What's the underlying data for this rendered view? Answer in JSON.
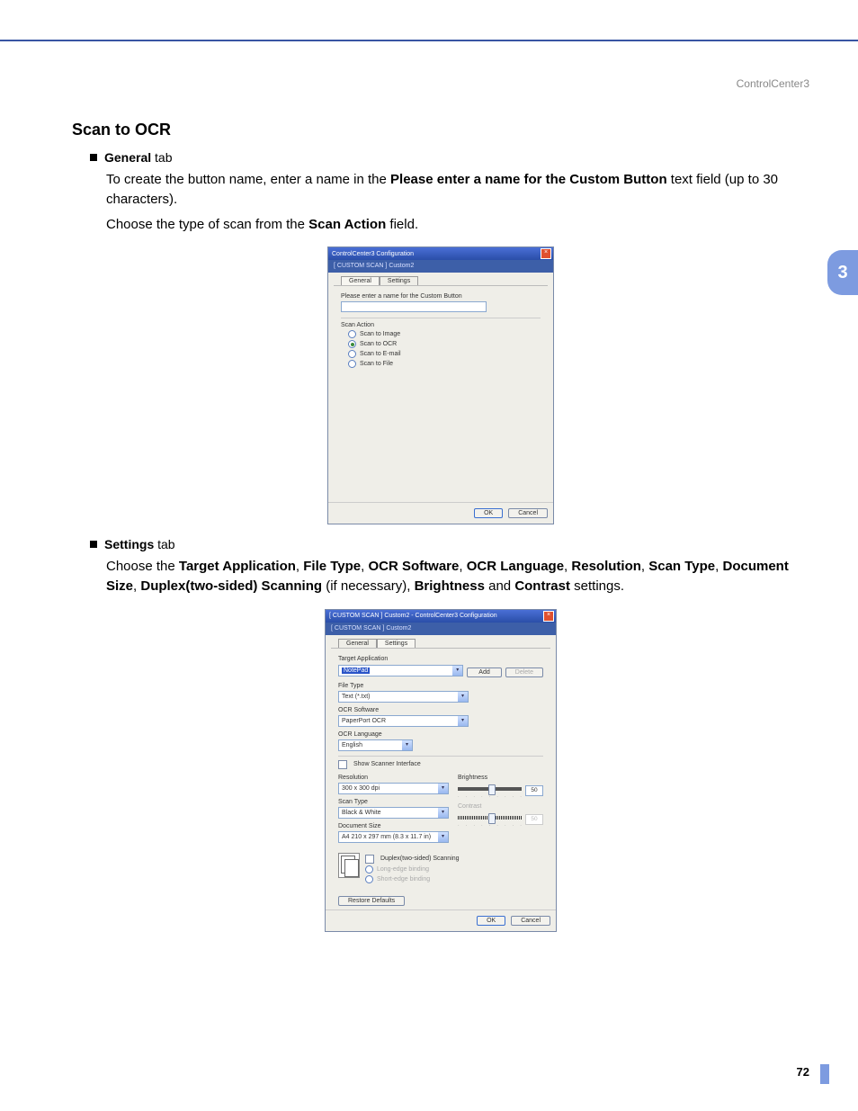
{
  "breadcrumb": "ControlCenter3",
  "section_title": "Scan to OCR",
  "general_tab": {
    "bullet_bold": "General",
    "bullet_suffix": " tab",
    "para1_pre": "To create the button name, enter a name in the ",
    "para1_bold": "Please enter a name for the Custom Button",
    "para1_post": " text field (up to 30 characters).",
    "para2_pre": "Choose the type of scan from the ",
    "para2_bold": "Scan Action",
    "para2_post": " field."
  },
  "dialog1": {
    "titlebar": "ControlCenter3 Configuration",
    "subtitle": "[ CUSTOM SCAN ]  Custom2",
    "tab_general": "General",
    "tab_settings": "Settings",
    "name_label": "Please enter a name for the Custom Button",
    "scan_action_label": "Scan Action",
    "opt_image": "Scan to Image",
    "opt_ocr": "Scan to OCR",
    "opt_email": "Scan to E-mail",
    "opt_file": "Scan to File",
    "ok": "OK",
    "cancel": "Cancel"
  },
  "settings_tab": {
    "bullet_bold": "Settings",
    "bullet_suffix": " tab",
    "pre": "Choose the ",
    "b1": "Target Application",
    "b2": "File Type",
    "b3": "OCR Software",
    "b4": "OCR Language",
    "b5": "Resolution",
    "b6": "Scan Type",
    "b7": "Document Size",
    "b8": "Duplex(two-sided) Scanning",
    "mid": " (if necessary), ",
    "b9": "Brightness",
    "and": " and ",
    "b10": "Contrast",
    "post": " settings."
  },
  "dialog2": {
    "titlebar": "[ CUSTOM SCAN ]  Custom2 - ControlCenter3 Configuration",
    "subtitle": "[ CUSTOM SCAN ]  Custom2",
    "tab_general": "General",
    "tab_settings": "Settings",
    "target_app_label": "Target Application",
    "target_app_value": "NotePad",
    "add_btn": "Add",
    "delete_btn": "Delete",
    "file_type_label": "File Type",
    "file_type_value": "Text (*.txt)",
    "ocr_sw_label": "OCR Software",
    "ocr_sw_value": "PaperPort OCR",
    "ocr_lang_label": "OCR Language",
    "ocr_lang_value": "English",
    "show_scanner": "Show Scanner Interface",
    "resolution_label": "Resolution",
    "resolution_value": "300 x 300 dpi",
    "scan_type_label": "Scan Type",
    "scan_type_value": "Black & White",
    "doc_size_label": "Document Size",
    "doc_size_value": "A4 210 x 297 mm (8.3 x 11.7 in)",
    "duplex_check": "Duplex(two-sided) Scanning",
    "duplex_long": "Long-edge binding",
    "duplex_short": "Short-edge binding",
    "brightness_label": "Brightness",
    "brightness_value": "50",
    "contrast_label": "Contrast",
    "contrast_value": "50",
    "restore": "Restore Defaults",
    "ok": "OK",
    "cancel": "Cancel"
  },
  "chapter_tab": "3",
  "page_number": "72"
}
